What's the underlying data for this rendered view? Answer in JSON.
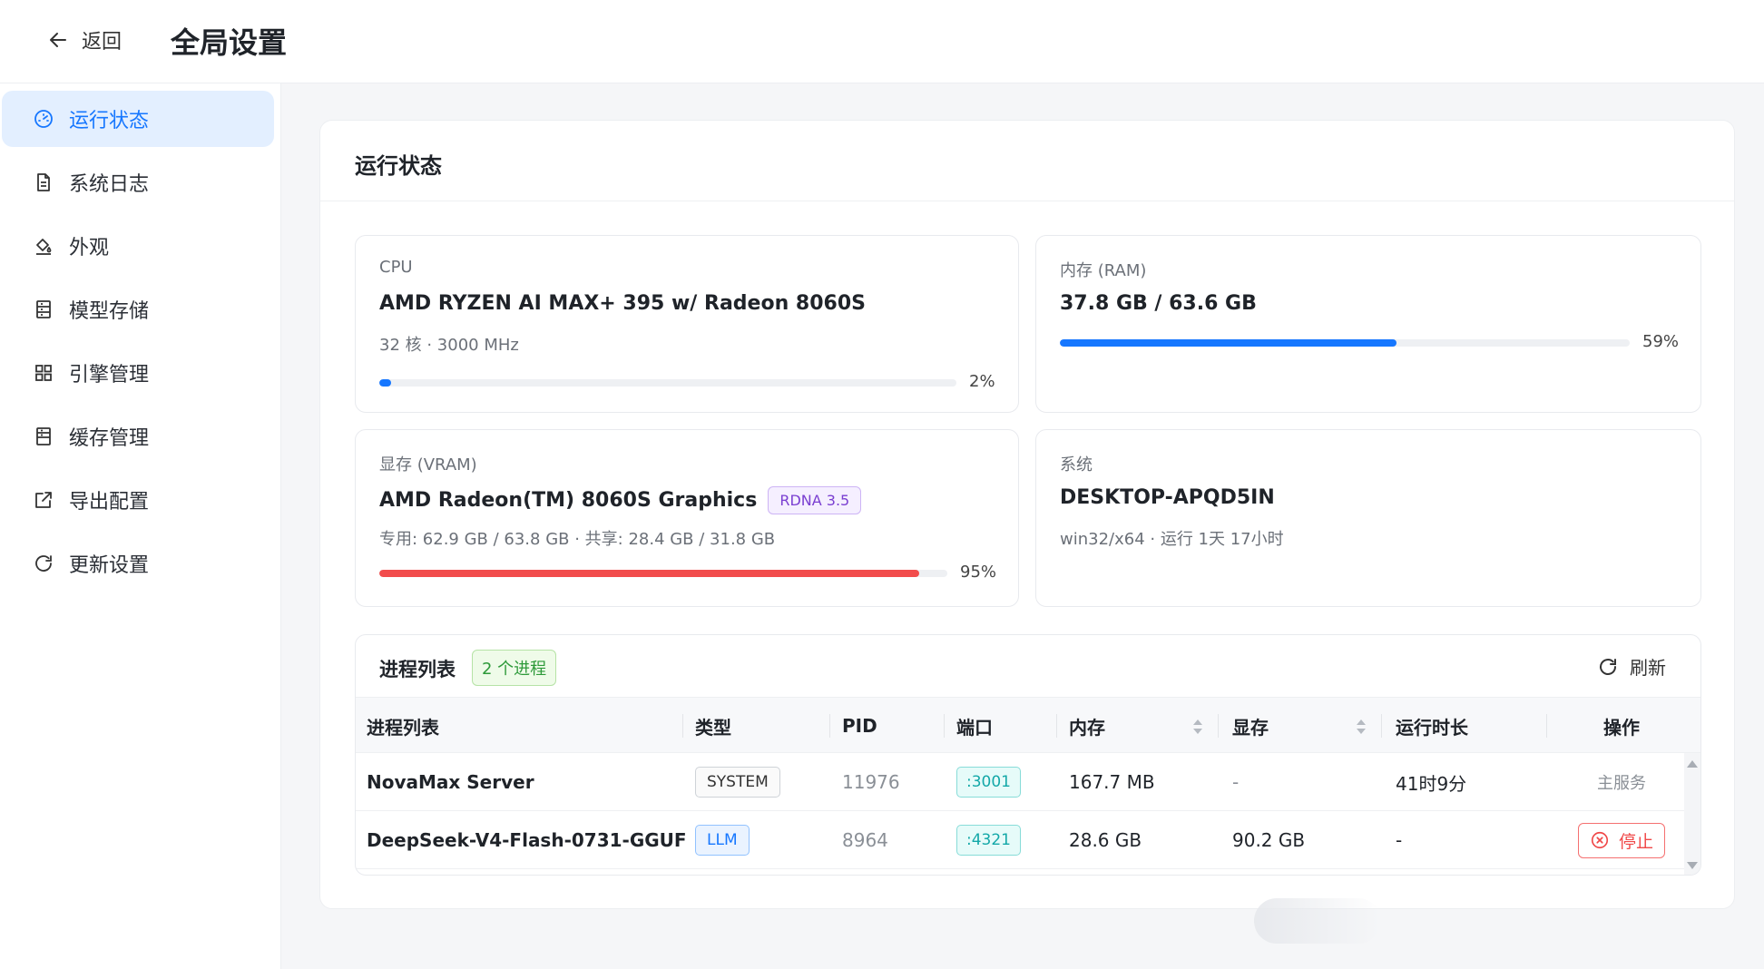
{
  "header": {
    "back_label": "返回",
    "title": "全局设置"
  },
  "sidebar": {
    "items": [
      {
        "label": "运行状态",
        "icon": "gauge-icon",
        "active": true
      },
      {
        "label": "系统日志",
        "icon": "document-icon"
      },
      {
        "label": "外观",
        "icon": "paint-bucket-icon"
      },
      {
        "label": "模型存储",
        "icon": "storage-icon"
      },
      {
        "label": "引擎管理",
        "icon": "grid-icon"
      },
      {
        "label": "缓存管理",
        "icon": "database-icon"
      },
      {
        "label": "导出配置",
        "icon": "export-icon"
      },
      {
        "label": "更新设置",
        "icon": "refresh-icon"
      }
    ]
  },
  "main": {
    "title": "运行状态",
    "cpu": {
      "label": "CPU",
      "name": "AMD RYZEN AI MAX+ 395 w/ Radeon 8060S",
      "detail": "32 核 · 3000 MHz",
      "usage_percent": 2,
      "usage_label": "2%",
      "bar_color": "#1677ff"
    },
    "ram": {
      "label": "内存 (RAM)",
      "value": "37.8 GB / 63.6 GB",
      "usage_percent": 59,
      "usage_label": "59%",
      "bar_color": "#1677ff"
    },
    "vram": {
      "label": "显存 (VRAM)",
      "name": "AMD Radeon(TM) 8060S Graphics",
      "badge": "RDNA 3.5",
      "detail": "专用: 62.9 GB / 63.8 GB · 共享: 28.4 GB / 31.8 GB",
      "usage_percent": 95,
      "usage_label": "95%",
      "bar_color": "#f24c4c"
    },
    "system": {
      "label": "系统",
      "hostname": "DESKTOP-APQD5IN",
      "detail": "win32/x64 · 运行 1天 17小时"
    },
    "processes": {
      "title": "进程列表",
      "count_badge": "2 个进程",
      "refresh_label": "刷新",
      "columns": [
        "进程列表",
        "类型",
        "PID",
        "端口",
        "内存",
        "显存",
        "运行时长",
        "操作"
      ],
      "rows": [
        {
          "name": "NovaMax Server",
          "type": "SYSTEM",
          "pid": "11976",
          "port": ":3001",
          "memory": "167.7 MB",
          "vram": "-",
          "uptime": "41时9分",
          "action": "主服务"
        },
        {
          "name": "DeepSeek-V4-Flash-0731-GGUF",
          "type": "LLM",
          "pid": "8964",
          "port": ":4321",
          "memory": "28.6 GB",
          "vram": "90.2 GB",
          "uptime": "-",
          "action": "停止"
        }
      ]
    }
  },
  "colors": {
    "accent": "#1677ff",
    "danger": "#f24c4c",
    "success": "#2e9a3a",
    "teal": "#13a8a8",
    "purple": "#7a3fd1"
  }
}
